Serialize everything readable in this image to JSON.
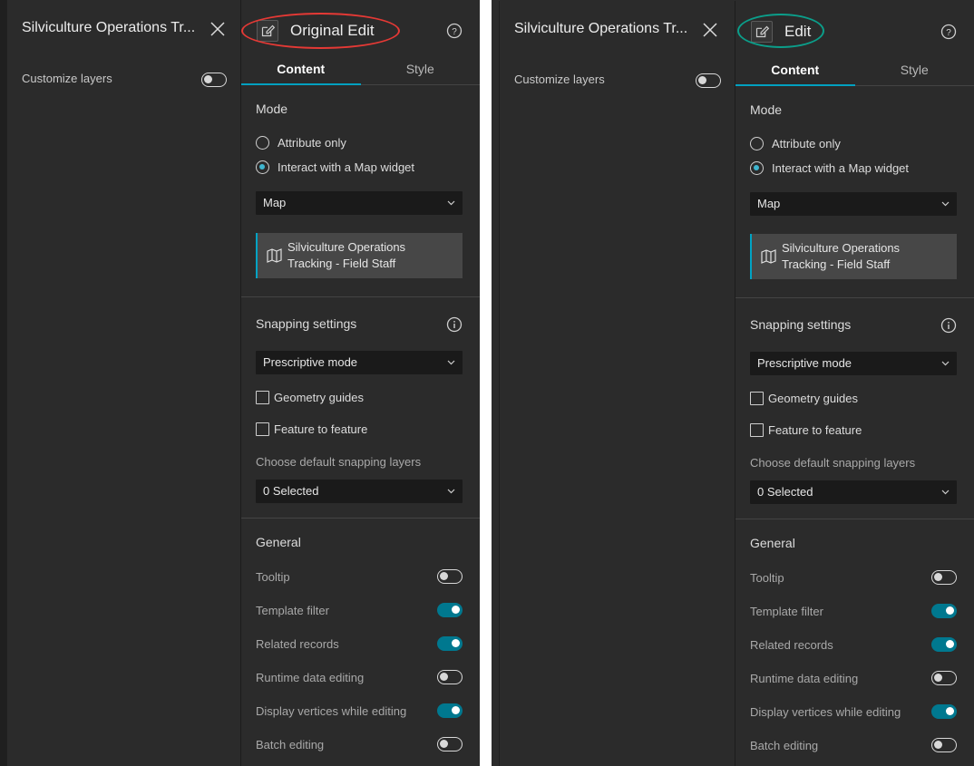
{
  "colors": {
    "panel_bg": "#2b2b2b",
    "accent": "#00a3c4",
    "toggle_on": "#00788f",
    "left_highlight_oval": "#e53935",
    "right_highlight_oval": "#0b9e8a"
  },
  "screens": [
    {
      "layer_panel": {
        "title": "Silviculture Operations Tr...",
        "customize_label": "Customize layers",
        "customize_on": false
      },
      "settings": {
        "title": "Original Edit",
        "tabs": [
          {
            "label": "Content",
            "active": true
          },
          {
            "label": "Style",
            "active": false
          }
        ],
        "mode": {
          "title": "Mode",
          "options": [
            {
              "label": "Attribute only",
              "checked": false
            },
            {
              "label": "Interact with a Map widget",
              "checked": true
            }
          ],
          "map_select": "Map",
          "map_card": "Silviculture Operations Tracking - Field Staff"
        },
        "snapping": {
          "title": "Snapping settings",
          "mode_select": "Prescriptive mode",
          "checks": [
            {
              "label": "Geometry guides",
              "checked": false
            },
            {
              "label": "Feature to feature",
              "checked": false
            }
          ],
          "layers_label": "Choose default snapping layers",
          "layers_select": "0 Selected"
        },
        "general": {
          "title": "General",
          "items": [
            {
              "label": "Tooltip",
              "on": false
            },
            {
              "label": "Template filter",
              "on": true
            },
            {
              "label": "Related records",
              "on": true
            },
            {
              "label": "Runtime data editing",
              "on": false
            },
            {
              "label": "Display vertices while editing",
              "on": true
            },
            {
              "label": "Batch editing",
              "on": false
            }
          ]
        }
      }
    },
    {
      "layer_panel": {
        "title": "Silviculture Operations Tr...",
        "customize_label": "Customize layers",
        "customize_on": false
      },
      "settings": {
        "title": "Edit",
        "tabs": [
          {
            "label": "Content",
            "active": true
          },
          {
            "label": "Style",
            "active": false
          }
        ],
        "mode": {
          "title": "Mode",
          "options": [
            {
              "label": "Attribute only",
              "checked": false
            },
            {
              "label": "Interact with a Map widget",
              "checked": true
            }
          ],
          "map_select": "Map",
          "map_card": "Silviculture Operations Tracking - Field Staff"
        },
        "snapping": {
          "title": "Snapping settings",
          "mode_select": "Prescriptive mode",
          "checks": [
            {
              "label": "Geometry guides",
              "checked": false
            },
            {
              "label": "Feature to feature",
              "checked": false
            }
          ],
          "layers_label": "Choose default snapping layers",
          "layers_select": "0 Selected"
        },
        "general": {
          "title": "General",
          "items": [
            {
              "label": "Tooltip",
              "on": false
            },
            {
              "label": "Template filter",
              "on": true
            },
            {
              "label": "Related records",
              "on": true
            },
            {
              "label": "Runtime data editing",
              "on": false
            },
            {
              "label": "Display vertices while editing",
              "on": true
            },
            {
              "label": "Batch editing",
              "on": false
            }
          ]
        }
      }
    }
  ]
}
